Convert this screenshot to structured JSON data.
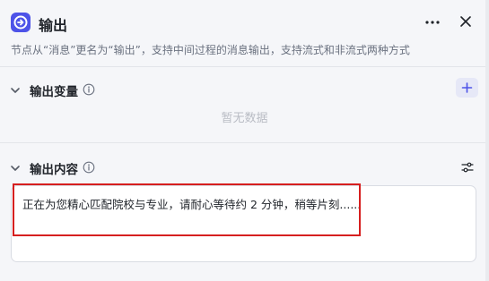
{
  "node": {
    "title": "输出",
    "description": "节点从“消息”更名为“输出”，支持中间过程的消息输出，支持流式和非流式两种方式"
  },
  "output_variables": {
    "title": "输出变量",
    "empty_text": "暂无数据"
  },
  "output_content": {
    "title": "输出内容",
    "value": "正在为您精心匹配院校与专业，请耐心等待约 2 分钟，稍等片刻......"
  },
  "icons": {
    "node": "output-node-icon",
    "more": "more-icon",
    "close": "close-icon",
    "collapse": "chevron-down-icon",
    "info": "info-icon",
    "add": "plus-icon",
    "settings": "settings-sliders-icon"
  },
  "colors": {
    "accent": "#4d53e8",
    "highlight": "#d61f1f"
  }
}
